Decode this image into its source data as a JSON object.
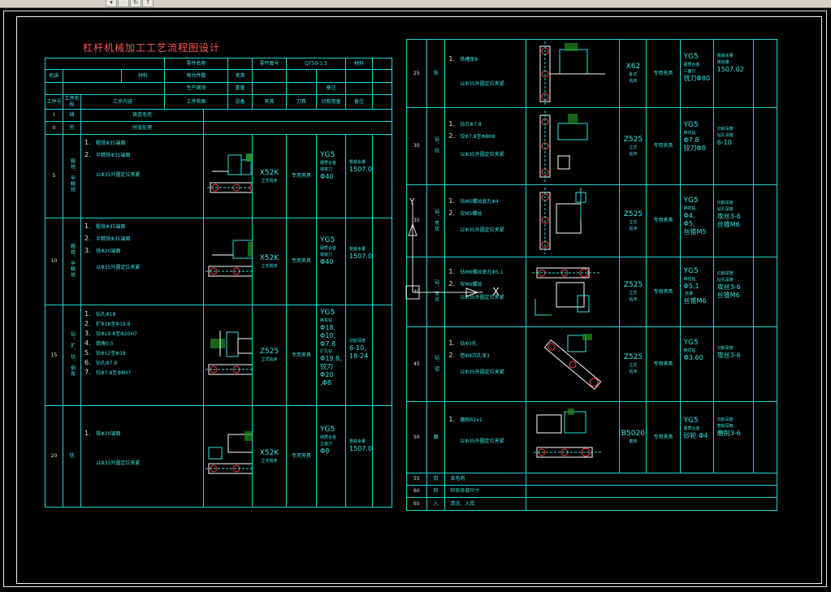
{
  "drawing": {
    "title": "杠杆机械加工工艺流程图设计",
    "part_code": "QT50-1.5"
  },
  "colors": {
    "background": "#000000",
    "grid": "#1fd3d3",
    "title": "#ff5555",
    "text": "#dcdcdc",
    "frame": "#e8e8e8"
  },
  "left": {
    "header": {
      "r1a": "零件名称",
      "r1b": "零件图号",
      "r1c": "QT50-1.5",
      "r1d": "材料",
      "r2a": "机床",
      "r2b": "材料",
      "r2c": "每台件数",
      "r2d": "夹具",
      "r3": "生产纲领",
      "r3b": "重量",
      "r3c": "备注"
    },
    "colhead": [
      "工序号",
      "工序名称",
      "工步内容",
      "工序简图",
      "设备",
      "夹具",
      "刀具",
      "切削用量",
      "备注"
    ],
    "ops": [
      {
        "no": "I",
        "name": "铸",
        "content": "铸造毛坯"
      },
      {
        "no": "II",
        "name": "热",
        "content": "时效处理"
      },
      {
        "no": "5",
        "name": "粗铣、半精铣",
        "steps": [
          "1.",
          "2."
        ],
        "lines": [
          "粗铣Φ35端面",
          "半精铣Φ35端面",
          "以Φ35外圆定位夹紧"
        ],
        "machine": "X52K",
        "machine_sub": "立式铣床",
        "fixture": "专用夹具",
        "tool": "YG5",
        "tool_sub": [
          "硬质合金",
          "端铣刀",
          "Φ40"
        ],
        "cut": [
          "粗铣余量",
          "1507.02"
        ]
      },
      {
        "no": "10",
        "name": "粗铣、半精铣",
        "steps": [
          "1.",
          "2.",
          "3."
        ],
        "lines": [
          "粗铣Φ35端面",
          "半精铣Φ35端面",
          "铣Φ20端面",
          "以Φ35外圆定位夹紧"
        ],
        "machine": "X52K",
        "machine_sub": "立式铣床",
        "fixture": "专用夹具",
        "tool": "YG5",
        "tool_sub": [
          "硬质合金",
          "端铣刀",
          "Φ40"
        ],
        "cut": [
          "粗铣余量",
          "1507.02"
        ]
      },
      {
        "no": "15",
        "name": "钻、扩、铰、倒角",
        "steps": [
          "1.",
          "2.",
          "3.",
          "4.",
          "5.",
          "6.",
          "7."
        ],
        "lines": [
          "钻孔Φ18",
          "扩Φ18至Φ19.8",
          "铰Φ19.8至Φ20H7",
          "倒角0.5",
          "钻Φ12至Φ18",
          "钻孔Φ7.8",
          "铰Φ7.8至Φ8H7"
        ],
        "machine": "Z525",
        "machine_sub": "立式钻床",
        "fixture": "专用夹具",
        "tool": "YG5",
        "tool_sub": [
          "麻花钻",
          "Φ18,",
          "Φ10,",
          "Φ7.8",
          "扩孔钻",
          "Φ19.8,",
          "铰刀Φ20",
          ",Φ8"
        ],
        "cut": [
          "切削深度",
          "6-10,",
          "18-24"
        ]
      },
      {
        "no": "20",
        "name": "铣",
        "steps": [
          "1."
        ],
        "lines": [
          "铣Φ20端面",
          "以Φ35外圆定位夹紧"
        ],
        "machine": "X52K",
        "machine_sub": "立式铣床",
        "fixture": "专用夹具",
        "tool": "YG5",
        "tool_sub": [
          "硬质合金",
          "立铣刀",
          "Φ8"
        ],
        "cut": [
          "粗铣余量",
          "1507.02"
        ]
      }
    ]
  },
  "right": {
    "ops": [
      {
        "no": "25",
        "name": "铣",
        "steps": [
          "1."
        ],
        "lines": [
          "铣槽宽8",
          "以Φ35外圆定位夹紧"
        ],
        "machine": "X62",
        "machine_sub": [
          "卧式",
          "铣床"
        ],
        "fixture": "专用夹具",
        "tool": "YG5",
        "tool_sub": [
          "硬质合金",
          "三面刃",
          "铣刀Φ80"
        ],
        "cut": [
          "粗铣余量",
          "粗铣量",
          "1507.02"
        ]
      },
      {
        "no": "30",
        "name": "钻、铰",
        "steps": [
          "1.",
          "2."
        ],
        "lines": [
          "钻孔Φ7.8",
          "铰Φ7.8至Φ8H8",
          "以Φ35外圆定位夹紧"
        ],
        "machine": "Z525",
        "machine_sub": [
          "立式",
          "钻床"
        ],
        "fixture": "专用夹具",
        "tool": "YG5",
        "tool_sub": [
          "麻花钻",
          "Φ7.8",
          "铰刀Φ8"
        ],
        "cut": [
          "切削深度",
          "钻孔深度",
          "6-10"
        ]
      },
      {
        "no": "35",
        "name": "钻、攻丝",
        "steps": [
          "1.",
          "2."
        ],
        "lines": [
          "钻M5螺纹底孔Φ4",
          "攻M5螺纹",
          "以Φ35外圆定位夹紧"
        ],
        "machine": "Z525",
        "machine_sub": [
          "立式",
          "钻床"
        ],
        "fixture": "专用夹具",
        "tool": "YG5",
        "tool_sub": [
          "麻花钻",
          "Φ4,",
          "Φ5,",
          "丝锥M5"
        ],
        "cut": [
          "切削深度",
          "钻孔深度",
          "攻丝3-6",
          "丝锥M6"
        ]
      },
      {
        "no": "40",
        "name": "钻、攻丝",
        "steps": [
          "1.",
          "2."
        ],
        "lines": [
          "钻M6螺纹底孔Φ5.1",
          "攻M6螺纹",
          "以Φ35外圆定位夹紧"
        ],
        "machine": "Z525",
        "machine_sub": [
          "立式",
          "钻床"
        ],
        "fixture": "专用夹具",
        "tool": "YG5",
        "tool_sub": [
          "麻花钻",
          "Φ5.1",
          ",丝锥",
          "丝锥M6"
        ],
        "cut": [
          "切削深度",
          "钻孔深度",
          "攻丝3-6",
          "丝锥M6"
        ]
      },
      {
        "no": "45",
        "name": "钻、锪",
        "steps": [
          "1.",
          "2."
        ],
        "lines": [
          "钻Φ3孔",
          "锪Φ8沉孔深3",
          "以Φ35外圆定位夹紧"
        ],
        "machine": "Z525",
        "machine_sub": [
          "立式",
          "钻床"
        ],
        "fixture": "专用夹具",
        "tool": "YG5",
        "tool_sub": [
          "麻花钻",
          "Φ3.60"
        ],
        "cut": [
          "切削深度",
          "攻丝3-6"
        ]
      },
      {
        "no": "50",
        "name": "磨",
        "steps": [
          "1."
        ],
        "lines": [
          "磨削R2x1",
          "以Φ35外圆定位夹紧"
        ],
        "machine": "B5020",
        "machine_sub": [
          "磨床"
        ],
        "fixture": "专用夹具",
        "tool": "YG5",
        "tool_sub": [
          "硬质合金",
          "砂轮 Φ4"
        ],
        "cut": [
          "切削深度",
          "磨削深度",
          "磨削3-6"
        ]
      },
      {
        "no": "55",
        "name": "钳",
        "content": "去毛刺"
      },
      {
        "no": "60",
        "name": "检",
        "content": "检验各部尺寸"
      },
      {
        "no": "65",
        "name": "入",
        "content": "清洗、入库"
      }
    ]
  },
  "ucs": {
    "y": "Y",
    "x": "X"
  }
}
